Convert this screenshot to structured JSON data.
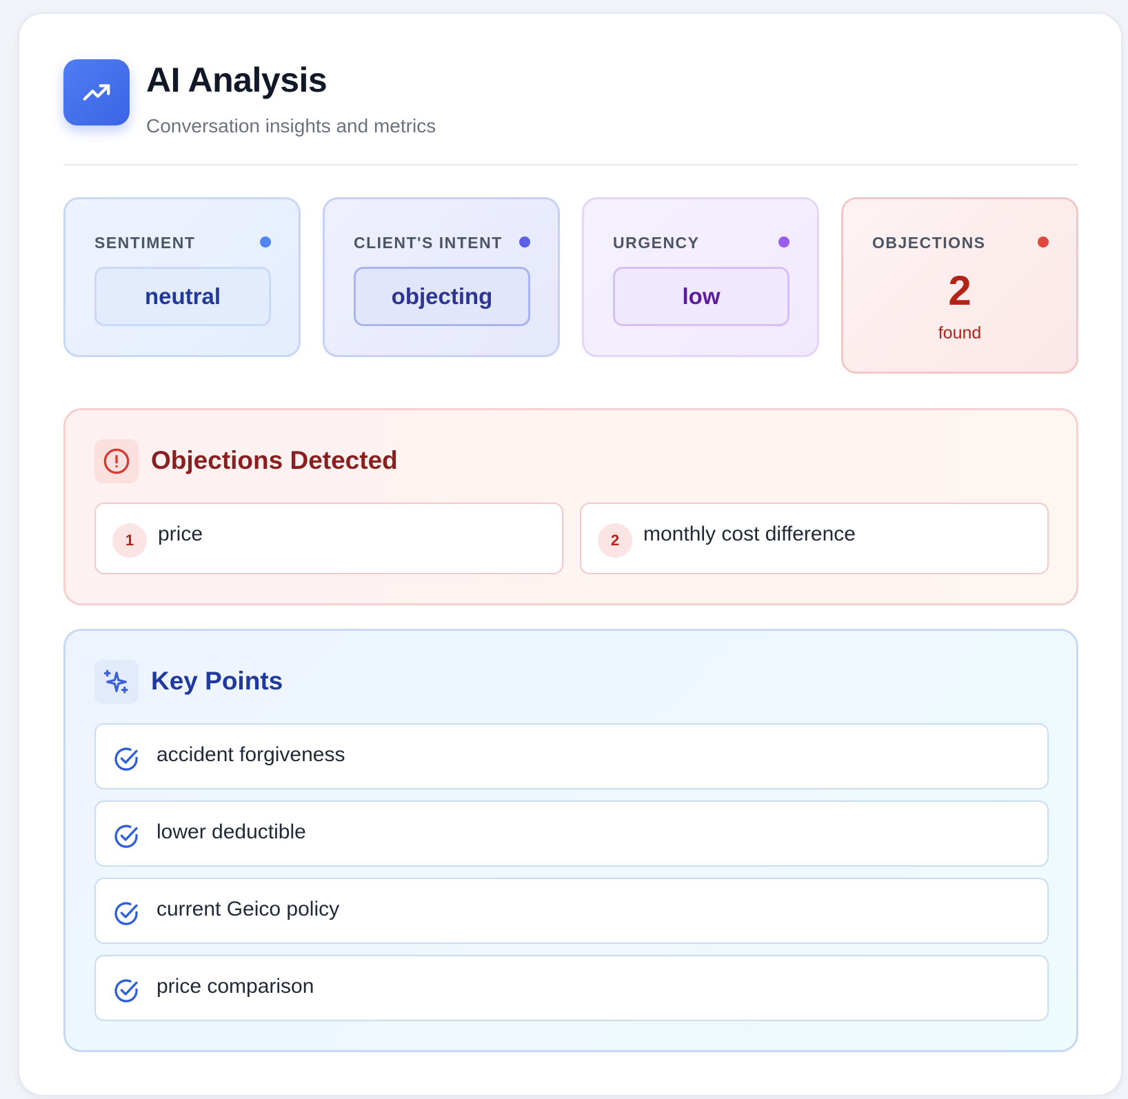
{
  "header": {
    "icon": "trending-up-icon",
    "title": "AI Analysis",
    "subtitle": "Conversation insights and metrics"
  },
  "metrics": [
    {
      "label": "SENTIMENT",
      "value": "neutral",
      "dot_color": "#4f86f0"
    },
    {
      "label": "CLIENT'S INTENT",
      "value": "objecting",
      "dot_color": "#5b60e8"
    },
    {
      "label": "URGENCY",
      "value": "low",
      "dot_color": "#9d5bec"
    },
    {
      "label": "OBJECTIONS",
      "count": "2",
      "count_label": "found",
      "dot_color": "#e0483e"
    }
  ],
  "objections": {
    "icon": "alert-circle-icon",
    "title": "Objections Detected",
    "items": [
      {
        "number": "1",
        "text": "price"
      },
      {
        "number": "2",
        "text": "monthly cost difference"
      }
    ]
  },
  "key_points": {
    "icon": "sparkles-icon",
    "title": "Key Points",
    "item_icon": "check-circle-icon",
    "items": [
      "accident forgiveness",
      "lower deductible",
      "current Geico policy",
      "price comparison"
    ]
  }
}
